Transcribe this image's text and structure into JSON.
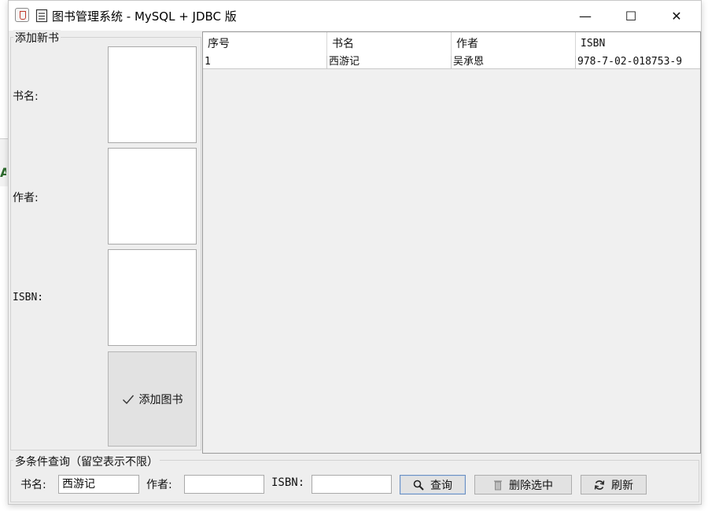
{
  "window": {
    "title": "图书管理系统 - MySQL + JDBC 版",
    "controls": {
      "minimize": "—",
      "maximize": "☐",
      "close": "✕"
    }
  },
  "add_panel": {
    "legend": "添加新书",
    "fields": [
      {
        "label": "书名:",
        "value": ""
      },
      {
        "label": "作者:",
        "value": ""
      },
      {
        "label": "ISBN:",
        "value": ""
      }
    ],
    "add_button": {
      "icon": "check-icon",
      "label": "添加图书"
    }
  },
  "table": {
    "columns": [
      "序号",
      "书名",
      "作者",
      "ISBN"
    ],
    "rows": [
      [
        "1",
        "西游记",
        "吴承恩",
        "978-7-02-018753-9"
      ]
    ]
  },
  "query_panel": {
    "legend": "多条件查询（留空表示不限）",
    "title_label": "书名:",
    "title_value": "西游记",
    "author_label": "作者:",
    "author_value": "",
    "isbn_label": "ISBN:",
    "isbn_value": "",
    "search_button": {
      "icon": "search-icon",
      "label": "查询"
    },
    "delete_button": {
      "icon": "trash-icon",
      "label": "删除选中"
    },
    "refresh_button": {
      "icon": "refresh-icon",
      "label": "刷新"
    }
  }
}
